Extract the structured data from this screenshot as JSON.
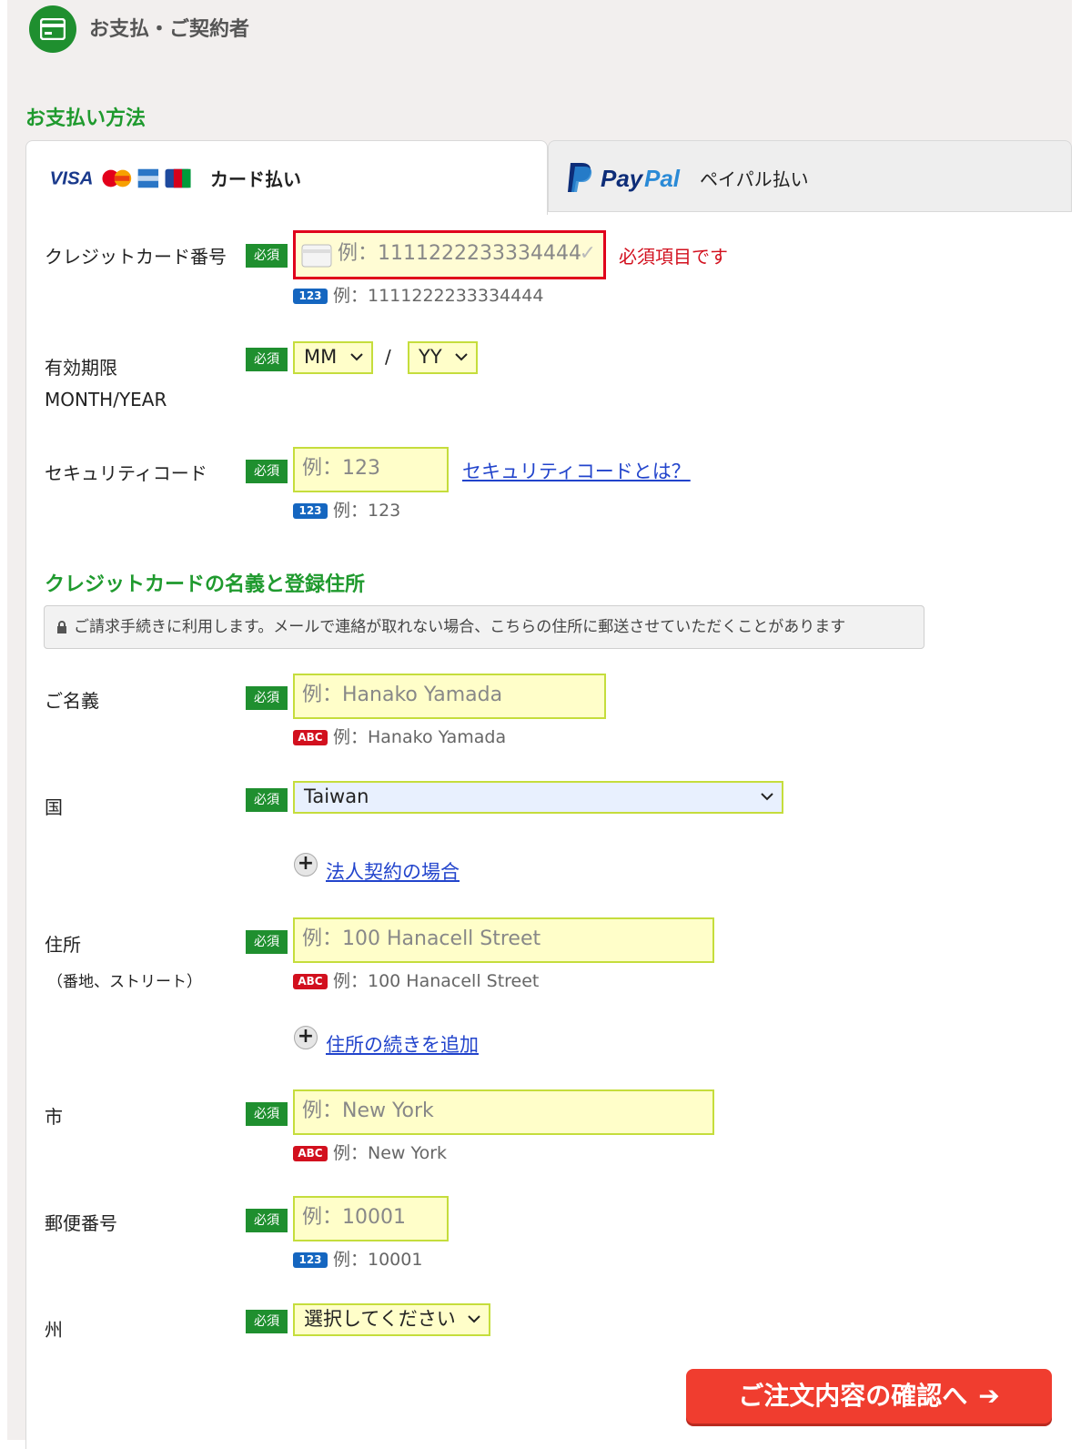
{
  "header": {
    "title": "お支払・ご契約者",
    "icon": "credit-card-icon"
  },
  "payment_method": {
    "title": "お支払い方法",
    "tabs": [
      {
        "label": "カード払い",
        "logos": [
          "VISA",
          "MasterCard",
          "AMEX",
          "JCB"
        ],
        "active": true
      },
      {
        "label": "ペイパル払い",
        "logo": "PayPal",
        "active": false
      }
    ]
  },
  "card_number": {
    "label": "クレジットカード番号",
    "required": "必須",
    "placeholder": "例：1111222233334444",
    "error": "必須項目です",
    "hint_badge": "123",
    "hint": "例：1111222233334444"
  },
  "expiry": {
    "label": "有効期限",
    "sublabel": "MONTH/YEAR",
    "required": "必須",
    "month": "MM",
    "separator": "/",
    "year": "YY"
  },
  "security_code": {
    "label": "セキュリティコード",
    "required": "必須",
    "placeholder": "例：123",
    "link": "セキュリティコードとは？",
    "hint_badge": "123",
    "hint": "例：123"
  },
  "holder_section": {
    "title": "クレジットカードの名義と登録住所",
    "notice": "ご請求手続きに利用します。メールで連絡が取れない場合、こちらの住所に郵送させていただくことがあります"
  },
  "name": {
    "label": "ご名義",
    "required": "必須",
    "placeholder": "例：Hanako Yamada",
    "hint_badge": "ABC",
    "hint": "例：Hanako Yamada"
  },
  "country": {
    "label": "国",
    "required": "必須",
    "value": "Taiwan",
    "corporate_link": "法人契約の場合"
  },
  "address": {
    "label": "住所",
    "sublabel": "（番地、ストリート）",
    "required": "必須",
    "placeholder": "例：100 Hanacell Street",
    "hint_badge": "ABC",
    "hint": "例：100 Hanacell Street",
    "add_link": "住所の続きを追加"
  },
  "city": {
    "label": "市",
    "required": "必須",
    "placeholder": "例：New York",
    "hint_badge": "ABC",
    "hint": "例：New York"
  },
  "postal": {
    "label": "郵便番号",
    "required": "必須",
    "placeholder": "例：10001",
    "hint_badge": "123",
    "hint": "例：10001"
  },
  "state": {
    "label": "州",
    "required": "必須",
    "value": "選択してください"
  },
  "confirm_button": "ご注文内容の確認へ",
  "colors": {
    "accent_green": "#1f9a2e",
    "required_bg": "#1f8f2f",
    "error_red": "#d2101e",
    "button_red": "#f03d2f",
    "input_bg": "#fffec9"
  }
}
